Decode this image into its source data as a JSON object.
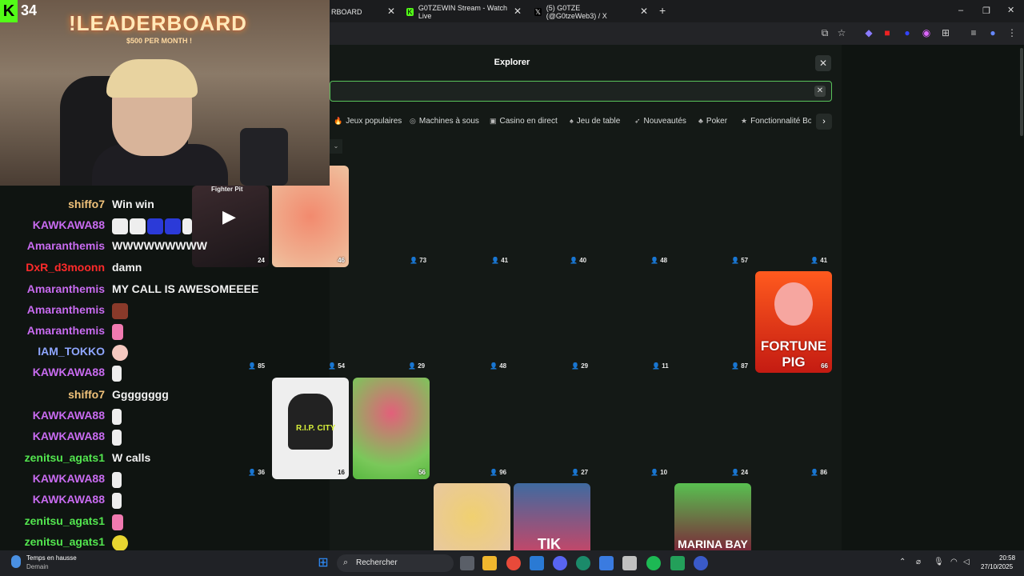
{
  "browser": {
    "tabs": [
      {
        "label": "RBOARD"
      },
      {
        "label": "G0TZEWIN Stream - Watch Live"
      },
      {
        "label": "(5) G0TZE (@G0tzeWeb3) / X"
      }
    ],
    "close_glyph": "✕",
    "new_tab_glyph": "+",
    "window_controls": [
      "–",
      "❐",
      "✕"
    ]
  },
  "modal": {
    "title": "Explorer",
    "close_glyph": "✕",
    "search_clear_glyph": "✕",
    "categories": [
      {
        "label": "Jeux populaires",
        "icon": "fire-icon"
      },
      {
        "label": "Machines à sous",
        "icon": "slot-icon"
      },
      {
        "label": "Casino en direct",
        "icon": "live-icon"
      },
      {
        "label": "Jeu de table",
        "icon": "cards-icon"
      },
      {
        "label": "Nouveautés",
        "icon": "rocket-icon"
      },
      {
        "label": "Poker",
        "icon": "poker-icon"
      },
      {
        "label": "Fonctionnalité Bo",
        "icon": "star-icon"
      }
    ],
    "next_glyph": "›",
    "dropdown_glyph": "⌄"
  },
  "games": {
    "fighter_pit": {
      "label": "Fighter Pit",
      "count": "24"
    },
    "tile_46": {
      "count": "46"
    },
    "fortune_pig": {
      "label": "FORTUNE PIG",
      "count": "66"
    },
    "rip_city": {
      "label": "R.I.P. CITY",
      "count": "16"
    },
    "tile_56": {
      "count": "56"
    },
    "marina_bay": {
      "label": "MARINA BAY"
    },
    "tik_label": "TIK",
    "row1_counts": [
      "73",
      "41",
      "40",
      "48",
      "57",
      "41"
    ],
    "row2_counts": [
      "85",
      "54",
      "29",
      "48",
      "29",
      "11",
      "87"
    ],
    "row3_counts": [
      "36",
      "96",
      "27",
      "10",
      "24",
      "86"
    ]
  },
  "stream": {
    "leaderboard_title": "!LEADERBOARD",
    "leaderboard_sub": "$500 PER MONTH !",
    "kick_logo": "K",
    "viewer_count": "34"
  },
  "chat": {
    "messages": [
      {
        "user": "shiffo7",
        "color": "#f0c27a",
        "text": "Win win"
      },
      {
        "user": "KAWKAWA88",
        "color": "#c86bf0",
        "text": ""
      },
      {
        "user": "Amaranthemis",
        "color": "#c86bf0",
        "text": "WWWWWWWWW"
      },
      {
        "user": "DxR_d3moonn",
        "color": "#ff2b2b",
        "text": "damn"
      },
      {
        "user": "Amaranthemis",
        "color": "#c86bf0",
        "text": "MY CALL IS AWESOMEEEE"
      },
      {
        "user": "Amaranthemis",
        "color": "#c86bf0",
        "text": ""
      },
      {
        "user": "Amaranthemis",
        "color": "#c86bf0",
        "text": ""
      },
      {
        "user": "IAM_TOKKO",
        "color": "#8fa6ff",
        "text": ""
      },
      {
        "user": "KAWKAWA88",
        "color": "#c86bf0",
        "text": ""
      },
      {
        "user": "shiffo7",
        "color": "#f0c27a",
        "text": "Gggggggg"
      },
      {
        "user": "KAWKAWA88",
        "color": "#c86bf0",
        "text": ""
      },
      {
        "user": "KAWKAWA88",
        "color": "#c86bf0",
        "text": ""
      },
      {
        "user": "zenitsu_agats1",
        "color": "#53e64f",
        "text": "W calls"
      },
      {
        "user": "KAWKAWA88",
        "color": "#c86bf0",
        "text": ""
      },
      {
        "user": "KAWKAWA88",
        "color": "#c86bf0",
        "text": ""
      },
      {
        "user": "zenitsu_agats1",
        "color": "#53e64f",
        "text": ""
      },
      {
        "user": "zenitsu_agats1",
        "color": "#53e64f",
        "text": ""
      }
    ]
  },
  "taskbar": {
    "weather_title": "Temps en hausse",
    "weather_sub": "Demain",
    "search_label": "Rechercher",
    "time": "20:58",
    "date": "27/10/2025"
  }
}
